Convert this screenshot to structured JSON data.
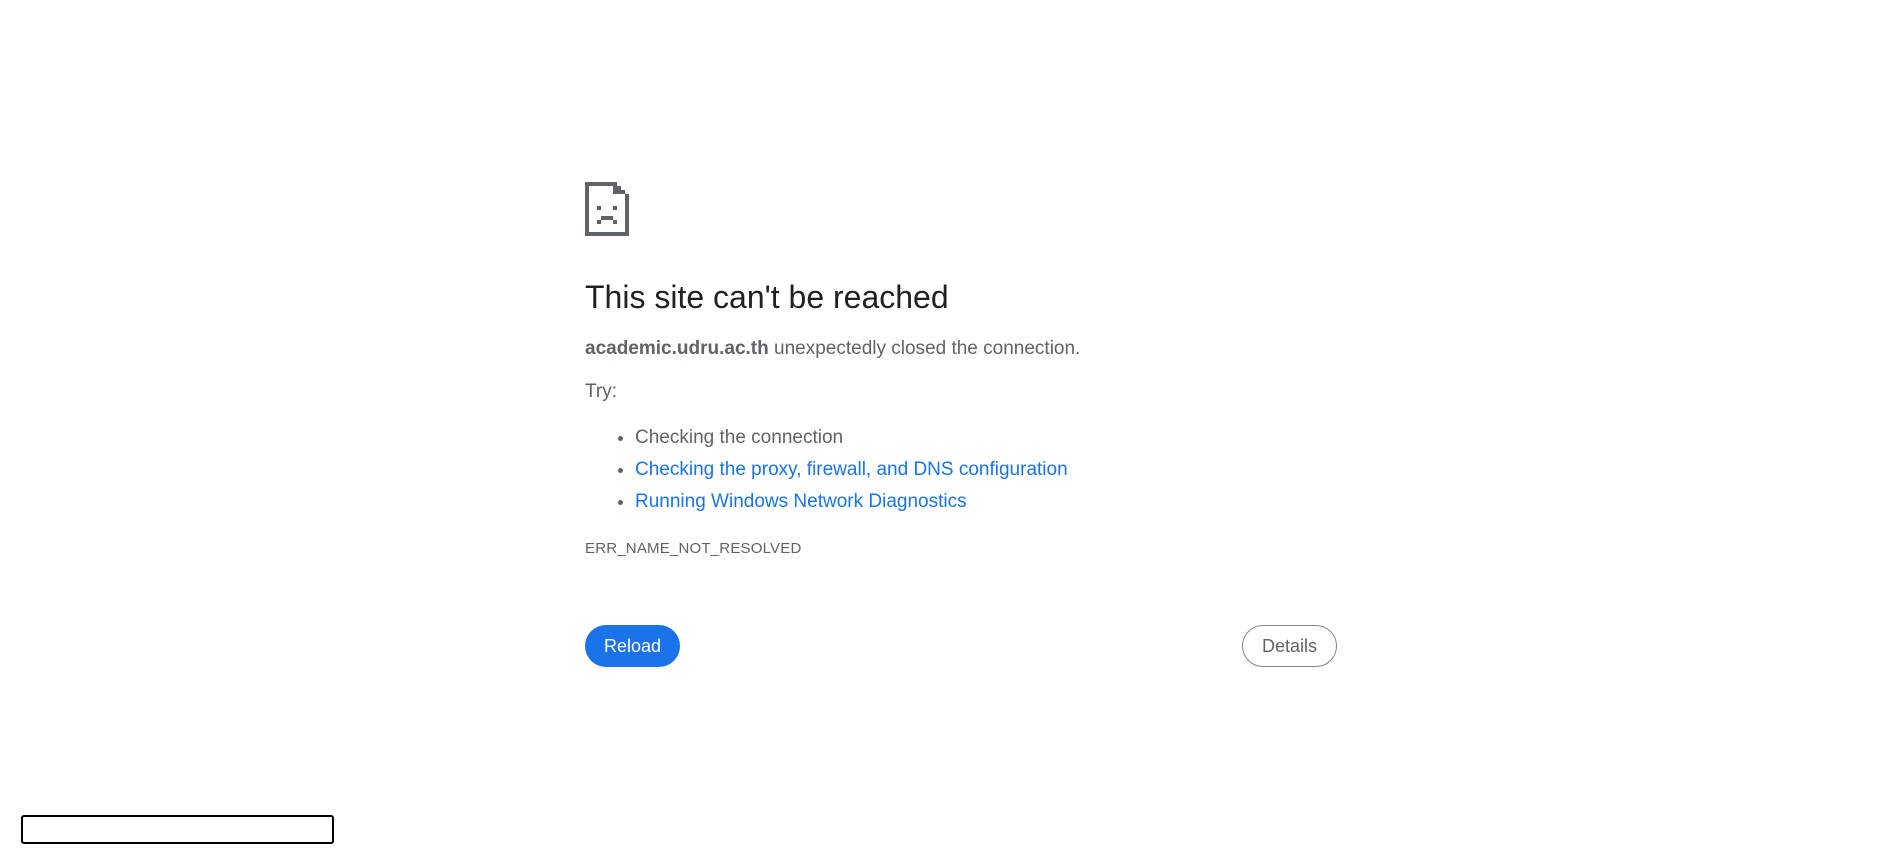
{
  "page": {
    "icon": "sad-document-icon",
    "title": "This site can't be reached",
    "host": "academic.udru.ac.th",
    "summary_rest": " unexpectedly closed the connection.",
    "try_label": "Try:",
    "suggestions": [
      {
        "label": "Checking the connection",
        "link": false
      },
      {
        "label": "Checking the proxy, firewall, and DNS configuration",
        "link": true
      },
      {
        "label": "Running Windows Network Diagnostics",
        "link": true
      }
    ],
    "error_code": "ERR_NAME_NOT_RESOLVED",
    "reload_label": "Reload",
    "details_label": "Details"
  },
  "colors": {
    "title": "#202124",
    "body_text": "#5f6368",
    "link": "#1a73e8",
    "primary_button": "#1a73e8"
  }
}
